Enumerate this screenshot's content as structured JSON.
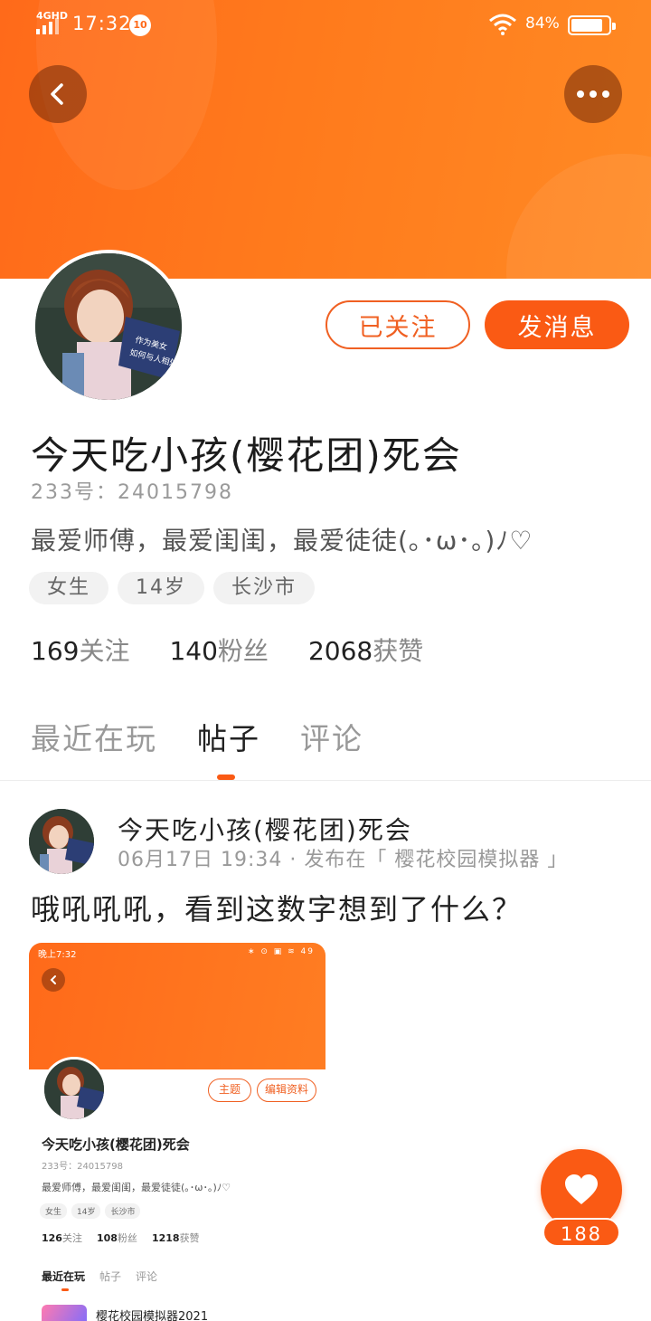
{
  "status_bar": {
    "network": "4GHD",
    "time": "17:32",
    "notification_count": "10",
    "battery_percent": "84%",
    "battery_level": 0.84
  },
  "header": {
    "back_icon": "chevron-left-icon",
    "more_icon": "more-dots-icon"
  },
  "profile": {
    "name": "今天吃小孩(樱花团)死会",
    "uid": "233号：24015798",
    "bio": "最爱师傅，最爱闺闺，最爱徒徒(｡･ω･｡)ﾉ♡",
    "tags": [
      "女生",
      "14岁",
      "长沙市"
    ],
    "stats": [
      {
        "num": "169",
        "label": "关注"
      },
      {
        "num": "140",
        "label": "粉丝"
      },
      {
        "num": "2068",
        "label": "获赞"
      }
    ],
    "followed_label": "已关注",
    "message_label": "发消息"
  },
  "tabs": [
    "最近在玩",
    "帖子",
    "评论"
  ],
  "active_tab": "帖子",
  "post": {
    "author": "今天吃小孩(樱花团)死会",
    "meta": "06月17日 19:34 · 发布在「 樱花校园模拟器 」",
    "text": "哦吼吼吼，看到这数字想到了什么？",
    "image": {
      "time": "晚上7:32",
      "status_right": "∗ ⊙ ▣ ≋ 49",
      "btn_topic": "主题",
      "btn_edit": "编辑资料",
      "name": "今天吃小孩(樱花团)死会",
      "uid": "233号：24015798",
      "bio": "最爱师傅，最爱闺闺，最爱徒徒(｡･ω･｡)ﾉ♡",
      "tags": [
        "女生",
        "14岁",
        "长沙市"
      ],
      "stats": [
        {
          "num": "126",
          "label": "关注"
        },
        {
          "num": "108",
          "label": "粉丝"
        },
        {
          "num": "1218",
          "label": "获赞"
        }
      ],
      "tabs": [
        "最近在玩",
        "帖子",
        "评论"
      ],
      "game_name": "樱花校园模拟器2021"
    }
  },
  "like": {
    "count": "188",
    "icon": "heart-icon"
  },
  "colors": {
    "accent": "#fa5a14",
    "banner": "#ff7a1c"
  }
}
